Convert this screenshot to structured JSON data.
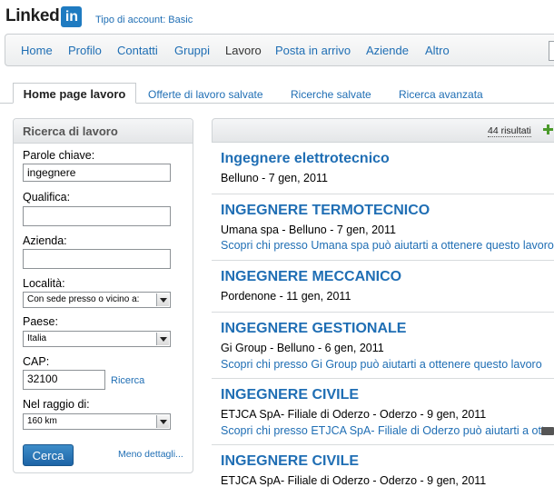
{
  "header": {
    "logo_text": "Linked",
    "logo_in": "in",
    "account_type": "Tipo di account: Basic"
  },
  "nav": {
    "items": [
      {
        "label": "Home"
      },
      {
        "label": "Profilo"
      },
      {
        "label": "Contatti"
      },
      {
        "label": "Gruppi"
      },
      {
        "label": "Lavoro"
      },
      {
        "label": "Posta in arrivo"
      },
      {
        "label": "Aziende"
      },
      {
        "label": "Altro"
      }
    ]
  },
  "tabs": {
    "active": "Home page lavoro",
    "others": [
      "Offerte di lavoro salvate",
      "Ricerche salvate",
      "Ricerca avanzata"
    ]
  },
  "search": {
    "title": "Ricerca di lavoro",
    "keywords_label": "Parole chiave:",
    "keywords_value": "ingegnere",
    "qualifica_label": "Qualifica:",
    "qualifica_value": "",
    "azienda_label": "Azienda:",
    "azienda_value": "",
    "localita_label": "Località:",
    "localita_value": "Con sede presso o vicino a:",
    "paese_label": "Paese:",
    "paese_value": "Italia",
    "cap_label": "CAP:",
    "cap_value": "32100",
    "ricerca_link": "Ricerca",
    "raggio_label": "Nel raggio di:",
    "raggio_value": "160 km",
    "search_button": "Cerca",
    "less_details": "Meno dettagli..."
  },
  "results": {
    "count": "44 risultati",
    "jobs": [
      {
        "title": "Ingegnere elettrotecnico",
        "meta": "Belluno - 7 gen, 2011",
        "link": ""
      },
      {
        "title": "INGEGNERE TERMOTECNICO",
        "meta": "Umana spa - Belluno - 7 gen, 2011",
        "link": "Scopri chi presso Umana spa può aiutarti a ottenere questo lavoro"
      },
      {
        "title": "INGEGNERE MECCANICO",
        "meta": "Pordenone - 11 gen, 2011",
        "link": ""
      },
      {
        "title": "INGEGNERE GESTIONALE",
        "meta": "Gi Group - Belluno - 6 gen, 2011",
        "link": "Scopri chi presso Gi Group può aiutarti a ottenere questo lavoro"
      },
      {
        "title": "INGEGNERE CIVILE",
        "meta": "ETJCA SpA- Filiale di Oderzo - Oderzo - 9 gen, 2011",
        "link": "Scopri chi presso ETJCA SpA- Filiale di Oderzo può aiutarti a ottenere"
      },
      {
        "title": "INGEGNERE CIVILE",
        "meta": "ETJCA SpA- Filiale di Oderzo - Oderzo - 9 gen, 2011",
        "link": ""
      }
    ]
  }
}
